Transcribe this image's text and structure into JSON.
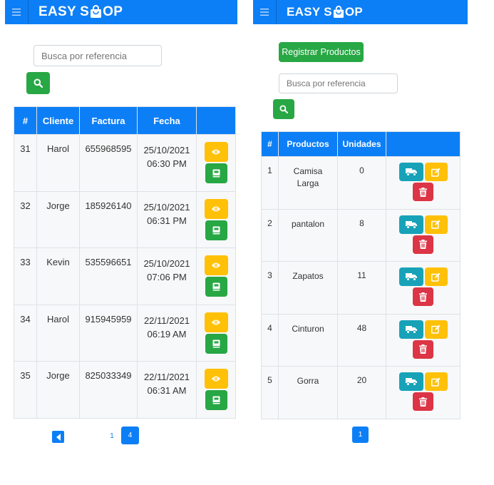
{
  "left": {
    "brand": {
      "pre": "EASY S",
      "post": "OP"
    },
    "search": {
      "placeholder": "Busca por referencia"
    },
    "table": {
      "headers": [
        "#",
        "Cliente",
        "Factura",
        "Fecha"
      ],
      "rows": [
        {
          "id": "31",
          "cliente": "Harol",
          "factura": "655968595",
          "fecha": "25/10/2021",
          "hora": "06:30 PM"
        },
        {
          "id": "32",
          "cliente": "Jorge",
          "factura": "185926140",
          "fecha": "25/10/2021",
          "hora": "06:31 PM"
        },
        {
          "id": "33",
          "cliente": "Kevin",
          "factura": "535596651",
          "fecha": "25/10/2021",
          "hora": "07:06 PM"
        },
        {
          "id": "34",
          "cliente": "Harol",
          "factura": "915945959",
          "fecha": "22/11/2021",
          "hora": "06:19 AM"
        },
        {
          "id": "35",
          "cliente": "Jorge",
          "factura": "825033349",
          "fecha": "22/11/2021",
          "hora": "06:31 AM"
        }
      ]
    },
    "pagination": {
      "pages": [
        "1",
        "4"
      ],
      "active": "4"
    }
  },
  "right": {
    "brand": {
      "pre": "EASY S",
      "post": "OP"
    },
    "register_label": "Registrar Productos",
    "search": {
      "placeholder": "Busca por referencia"
    },
    "table": {
      "headers": [
        "#",
        "Productos",
        "Unidades"
      ],
      "rows": [
        {
          "id": "1",
          "producto_l1": "Camisa",
          "producto_l2": "Larga",
          "unidades": "0"
        },
        {
          "id": "2",
          "producto_l1": "pantalon",
          "producto_l2": "",
          "unidades": "8"
        },
        {
          "id": "3",
          "producto_l1": "Zapatos",
          "producto_l2": "",
          "unidades": "11"
        },
        {
          "id": "4",
          "producto_l1": "Cinturon",
          "producto_l2": "",
          "unidades": "48"
        },
        {
          "id": "5",
          "producto_l1": "Gorra",
          "producto_l2": "",
          "unidades": "20"
        }
      ]
    },
    "pagination": {
      "pages": [
        "1"
      ],
      "active": "1"
    }
  },
  "icons": {
    "menu": "hamburger-icon",
    "bag": "shopping-bag-icon",
    "search": "search-icon",
    "view": "eye-icon",
    "invoice": "book-icon",
    "delivery": "truck-icon",
    "edit": "edit-icon",
    "delete": "trash-icon",
    "prev": "caret-left-icon"
  },
  "colors": {
    "primary": "#0d7ff6",
    "success": "#28a745",
    "warning": "#ffc107",
    "info": "#17a2b8",
    "danger": "#dc3545"
  }
}
